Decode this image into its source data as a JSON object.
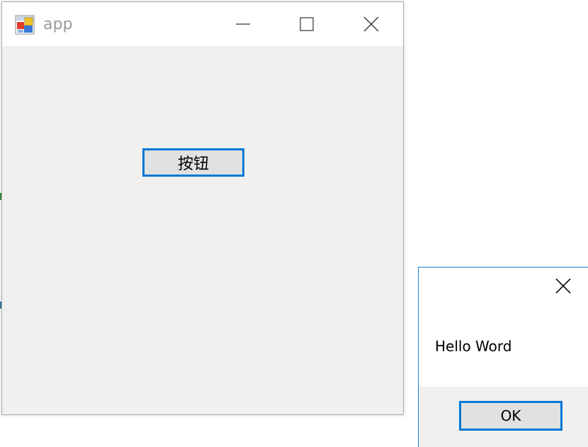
{
  "main_window": {
    "title": "app",
    "icon": "app-window-icon",
    "controls": {
      "minimize": "minimize-icon",
      "maximize": "maximize-icon",
      "close": "close-icon"
    },
    "button_label": "按钮"
  },
  "message_box": {
    "text": "Hello Word",
    "ok_label": "OK",
    "close": "close-icon"
  },
  "colors": {
    "accent": "#0078d7",
    "window_bg": "#f0f0f0",
    "titlebar_bg": "#ffffff",
    "button_bg": "#e1e1e1"
  }
}
